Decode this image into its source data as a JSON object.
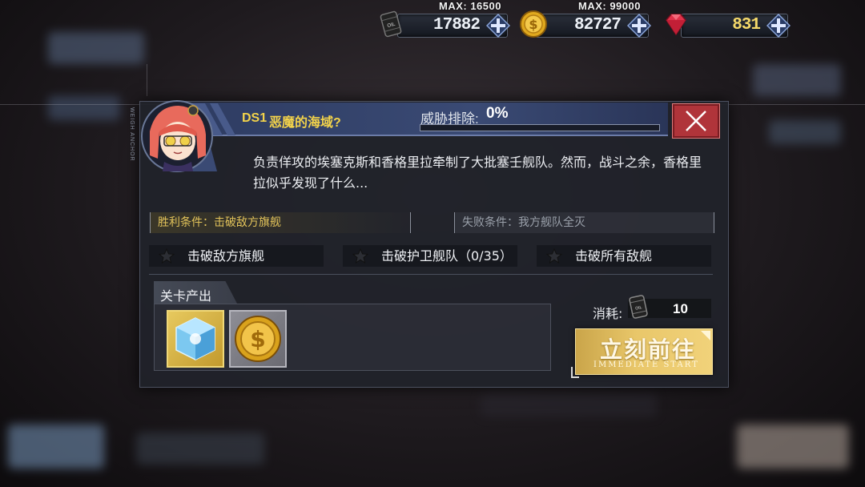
{
  "resources": {
    "oil": {
      "max_label": "MAX: 16500",
      "value": "17882",
      "icon": "oil-barrel-icon"
    },
    "gold": {
      "max_label": "MAX: 99000",
      "value": "82727",
      "icon": "gold-coin-icon"
    },
    "gems": {
      "value": "831",
      "icon": "ruby-gem-icon"
    }
  },
  "stage": {
    "code": "DS1",
    "name": "恶魔的海域?",
    "threat_label": "威胁排除:",
    "threat_value": "0%",
    "threat_progress": 0,
    "description": "负责佯攻的埃塞克斯和香格里拉牵制了大批塞壬舰队。然而，战斗之余，香格里拉似乎发现了什么...",
    "side_text": "WEIGH ANCHOR"
  },
  "conditions": {
    "win": "胜利条件：击破敌方旗舰",
    "lose": "失败条件：我方舰队全灭"
  },
  "goals": [
    {
      "text": "击破敌方旗舰"
    },
    {
      "text": "击破护卫舰队（0/35）"
    },
    {
      "text": "击破所有敌舰"
    }
  ],
  "drops": {
    "label": "关卡产出",
    "items": [
      "blue-cube-icon",
      "gold-coin-icon"
    ]
  },
  "cost": {
    "label": "消耗:",
    "value": "10",
    "icon": "oil-barrel-icon"
  },
  "start_button": {
    "label": "立刻前往",
    "sublabel": "IMMEDIATE START"
  },
  "colors": {
    "accent_gold": "#f3d34a",
    "close_red": "#b0343a",
    "title_blue": "#3a4a74"
  }
}
